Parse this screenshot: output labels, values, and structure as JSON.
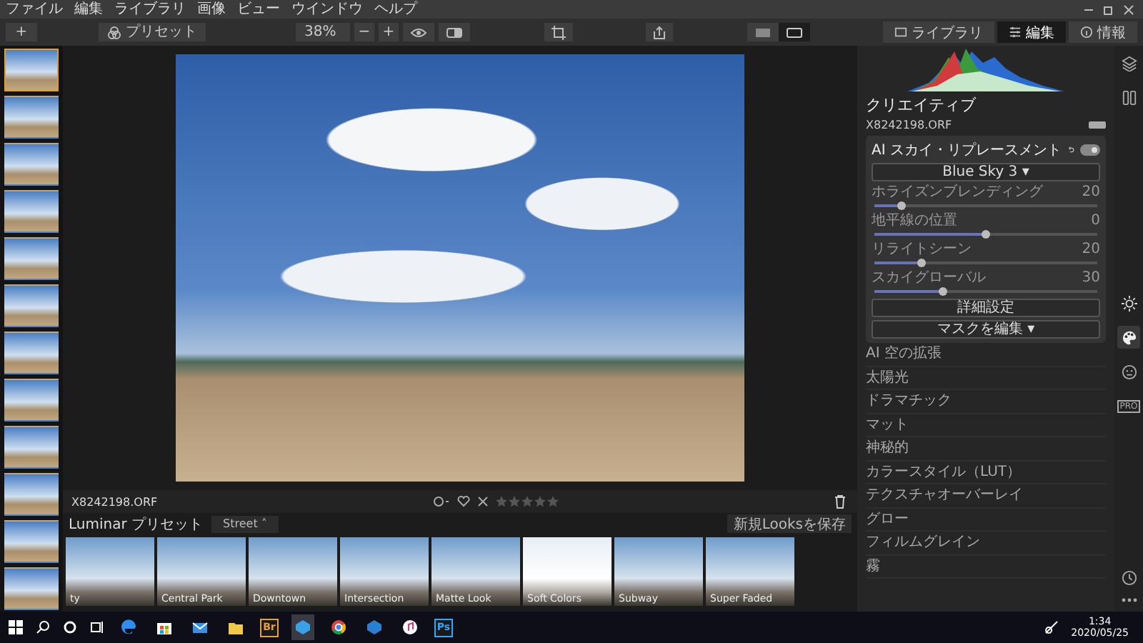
{
  "menu": [
    "ファイル",
    "編集",
    "ライブラリ",
    "画像",
    "ビュー",
    "ウインドウ",
    "ヘルプ"
  ],
  "toolbar": {
    "add": "+",
    "presets": "プリセット",
    "zoom": "38%",
    "zoom_out": "−",
    "zoom_in": "+",
    "views": [
      {
        "kind": "grid",
        "selected": false
      },
      {
        "kind": "single",
        "selected": true
      }
    ],
    "tabs": [
      {
        "label": "ライブラリ",
        "kind": "library",
        "selected": false
      },
      {
        "label": "編集",
        "kind": "edit",
        "selected": true
      },
      {
        "label": "情報",
        "kind": "info",
        "selected": false
      }
    ]
  },
  "filmstrip": [
    {
      "selected": true
    },
    {
      "selected": false
    },
    {
      "selected": false
    },
    {
      "selected": false
    },
    {
      "selected": false
    },
    {
      "selected": false
    },
    {
      "selected": false
    },
    {
      "selected": false
    },
    {
      "selected": false
    },
    {
      "selected": false
    },
    {
      "selected": false
    },
    {
      "selected": false
    }
  ],
  "image_bar": {
    "filename": "X8242198.ORF",
    "stars": 0
  },
  "presets": {
    "label": "Luminar プリセット",
    "category": "Street",
    "category_caret": "˄",
    "save": "新規Looksを保存",
    "items": [
      {
        "label": "ty",
        "kind": "sky"
      },
      {
        "label": "Central Park",
        "kind": "sky"
      },
      {
        "label": "Downtown",
        "kind": "sky"
      },
      {
        "label": "Intersection",
        "kind": "sky"
      },
      {
        "label": "Matte Look",
        "kind": "sky"
      },
      {
        "label": "Soft Colors",
        "kind": "soft"
      },
      {
        "label": "Subway",
        "kind": "sky"
      },
      {
        "label": "Super Faded",
        "kind": "sky"
      }
    ]
  },
  "panel": {
    "title": "クリエイティブ",
    "filename": "X8242198.ORF",
    "tool": {
      "title": "AI スカイ・リプレースメント",
      "enabled": true,
      "sky": "Blue Sky 3 ▾",
      "sliders": [
        {
          "label": "ホライズンブレンディング",
          "value": "20",
          "level": 0.12
        },
        {
          "label": "地平線の位置",
          "value": "0",
          "level": 0.5
        },
        {
          "label": "リライトシーン",
          "value": "20",
          "level": 0.21
        },
        {
          "label": "スカイグローバル",
          "value": "30",
          "level": 0.31
        }
      ],
      "advanced": "詳細設定",
      "mask": "マスクを編集 ▾"
    },
    "items": [
      "AI 空の拡張",
      "太陽光",
      "ドラマチック",
      "マット",
      "神秘的",
      "カラースタイル（LUT）",
      "テクスチャオーバーレイ",
      "グロー",
      "フィルムグレイン",
      "霧"
    ]
  },
  "side_icons": [
    {
      "kind": "layers",
      "selected": false
    },
    {
      "kind": "compare",
      "selected": false
    },
    {
      "kind": "sun",
      "selected": false
    },
    {
      "kind": "palette",
      "selected": true
    },
    {
      "kind": "face",
      "selected": false
    },
    {
      "kind": "pro",
      "selected": false
    }
  ],
  "side_pro": "PRO",
  "taskbar": {
    "apps": [
      {
        "kind": "edge"
      },
      {
        "kind": "store"
      },
      {
        "kind": "mail"
      },
      {
        "kind": "folder"
      },
      {
        "kind": "text",
        "label": "Br",
        "color": "#e8a13a"
      },
      {
        "kind": "cube",
        "active": true
      },
      {
        "kind": "chrome"
      },
      {
        "kind": "cube2"
      },
      {
        "kind": "music"
      },
      {
        "kind": "text",
        "label": "Ps",
        "color": "#31a8ff"
      }
    ],
    "time": "1:34",
    "date": "2020/05/25"
  }
}
